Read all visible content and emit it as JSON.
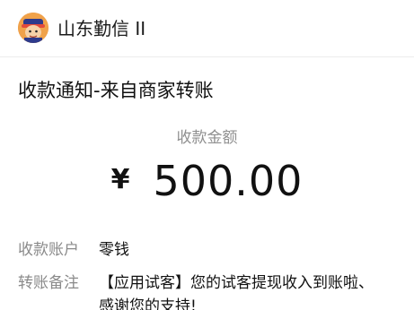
{
  "header": {
    "account_name": "山东勤信 II",
    "avatar_icon": "cartoon-character-avatar-icon"
  },
  "notice": {
    "title": "收款通知-来自商家转账"
  },
  "amount": {
    "label": "收款金额",
    "currency_symbol": "¥",
    "value": "500.00"
  },
  "details": {
    "account_key": "收款账户",
    "account_value": "零钱",
    "remark_key": "转账备注",
    "remark_value": "【应用试客】您的试客提现收入到账啦、感谢您的支持!"
  },
  "colors": {
    "avatar_bg": "#e7892f",
    "label_gray": "#8a8a8a",
    "text": "#111111"
  }
}
